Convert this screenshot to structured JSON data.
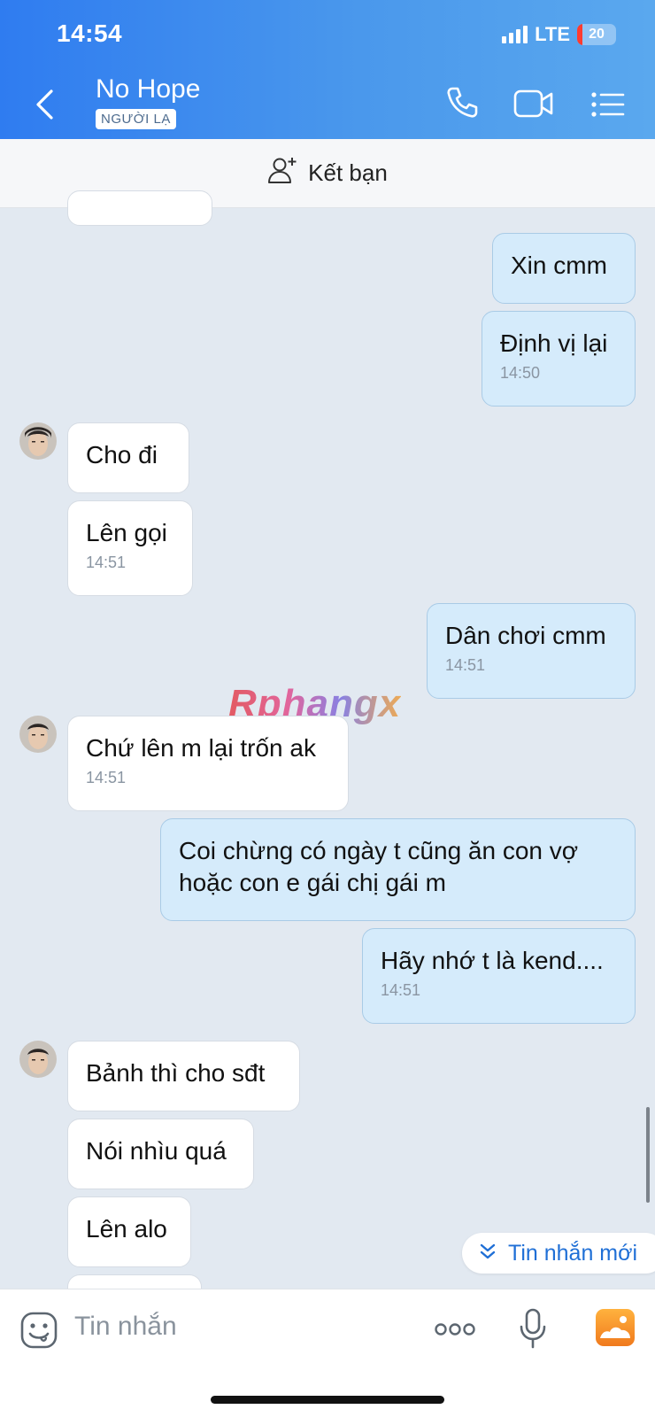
{
  "status_bar": {
    "time": "14:54",
    "network": "LTE",
    "battery": "20"
  },
  "header": {
    "contact_name": "No Hope",
    "badge": "NGƯỜI LẠ"
  },
  "friend_bar": {
    "label": "Kết bạn"
  },
  "messages": [
    {
      "dir": "out",
      "text": "Xin cmm",
      "time": ""
    },
    {
      "dir": "out",
      "text": "Định vị lại",
      "time": "14:50"
    },
    {
      "dir": "in",
      "text": "Cho đi",
      "time": ""
    },
    {
      "dir": "in",
      "text": "Lên gọi",
      "time": "14:51"
    },
    {
      "dir": "out",
      "text": "Dân chơi cmm",
      "time": "14:51"
    },
    {
      "dir": "in",
      "text": "Chứ lên m lại trốn ak",
      "time": "14:51"
    },
    {
      "dir": "out",
      "text": "Coi chừng có ngày t cũng ăn con vợ hoặc con e gái chị gái m",
      "time": ""
    },
    {
      "dir": "out",
      "text": "Hãy nhớ t là kend....",
      "time": "14:51"
    },
    {
      "dir": "in",
      "text": "Bảnh thì cho sđt",
      "time": ""
    },
    {
      "dir": "in",
      "text": "Nói nhìu quá",
      "time": ""
    },
    {
      "dir": "in",
      "text": "Lên alo",
      "time": ""
    }
  ],
  "watermark": "Rphangx",
  "new_messages_pill": {
    "label": "Tin nhắn mới"
  },
  "composer": {
    "placeholder": "Tin nhắn"
  },
  "colors": {
    "header_start": "#2f7cf0",
    "header_end": "#5aa8ee",
    "outgoing_bubble": "#d5ebfb",
    "incoming_bubble": "#ffffff",
    "chat_bg": "#e2e9f1",
    "accent": "#1f6fd6"
  },
  "icons": [
    "back-arrow-icon",
    "phone-icon",
    "video-camera-icon",
    "menu-list-icon",
    "add-friend-icon",
    "chevrons-down-icon",
    "sticker-icon",
    "more-dots-icon",
    "microphone-icon",
    "gallery-icon"
  ]
}
